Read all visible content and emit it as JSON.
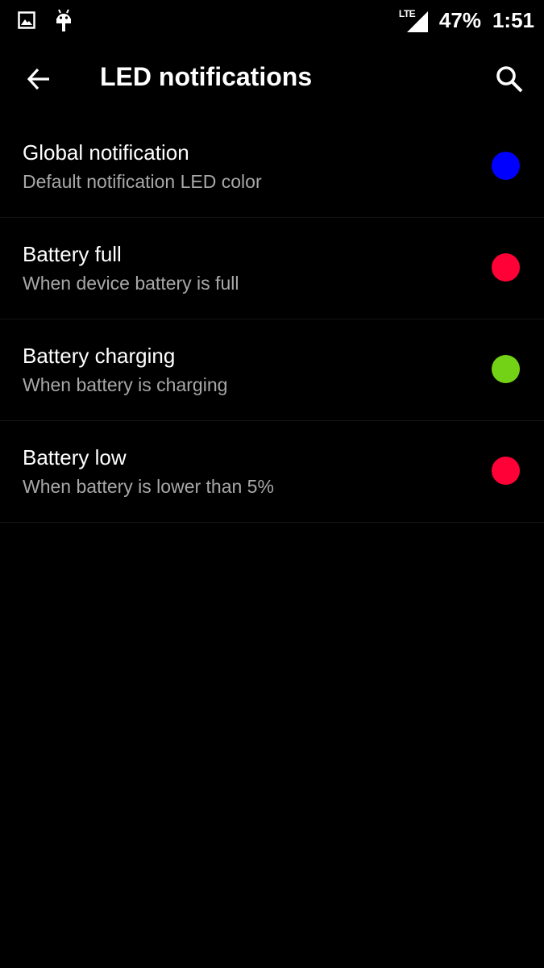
{
  "status_bar": {
    "icons_left": [
      "image-notification-icon",
      "android-notification-icon"
    ],
    "network": "LTE",
    "battery_percent": "47%",
    "time": "1:51"
  },
  "app_bar": {
    "title": "LED notifications",
    "back_icon": "arrow-back-icon",
    "search_icon": "search-icon"
  },
  "items": [
    {
      "title": "Global notification",
      "summary": "Default notification LED color",
      "color": "#0000ff"
    },
    {
      "title": "Battery full",
      "summary": "When device battery is full",
      "color": "#ff0037"
    },
    {
      "title": "Battery charging",
      "summary": "When battery is charging",
      "color": "#73d216"
    },
    {
      "title": "Battery low",
      "summary": "When battery is lower than 5%",
      "color": "#ff0037"
    }
  ],
  "colors": {
    "background": "#000000",
    "title_text": "#ffffff",
    "summary_text": "#a8a8a8",
    "divider": "#161616"
  }
}
